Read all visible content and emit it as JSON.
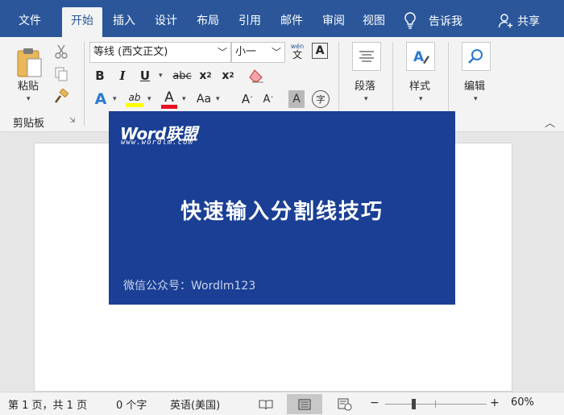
{
  "tabs": [
    {
      "label": "文件",
      "active": false
    },
    {
      "label": "开始",
      "active": true
    },
    {
      "label": "插入",
      "active": false
    },
    {
      "label": "设计",
      "active": false
    },
    {
      "label": "布局",
      "active": false
    },
    {
      "label": "引用",
      "active": false
    },
    {
      "label": "邮件",
      "active": false
    },
    {
      "label": "审阅",
      "active": false
    },
    {
      "label": "视图",
      "active": false
    }
  ],
  "tell_me": "告诉我",
  "share": "共享",
  "ribbon": {
    "clipboard": {
      "paste_label": "粘贴",
      "group_label": "剪贴板"
    },
    "font": {
      "font_name": "等线 (西文正文)",
      "font_size": "小一",
      "wen_top": "wén",
      "wen_char": "文",
      "bold": "B",
      "italic": "I",
      "underline": "U",
      "strike": "abc",
      "sub": "x",
      "sub_mark": "2",
      "sup": "x",
      "sup_mark": "2",
      "text_effect": "A",
      "highlight": "ab",
      "font_color": "A",
      "change_case": "Aa",
      "grow": "A",
      "shrink": "A",
      "char_shade": "A",
      "enclose": "字",
      "char_border": "A"
    },
    "paragraph_label": "段落",
    "styles_label": "样式",
    "editing_label": "编辑"
  },
  "banner": {
    "logo": "Word联盟",
    "logo_url": "www.wordlm.com",
    "headline": "快速输入分割线技巧",
    "wechat": "微信公众号：Wordlm123"
  },
  "status": {
    "page": "第 1 页，共 1 页",
    "words": "0 个字",
    "language": "英语(美国)",
    "zoom_minus": "−",
    "zoom_plus": "+",
    "zoom_percent": "60%",
    "zoom_level": 60
  },
  "colors": {
    "brand_blue": "#2b579a",
    "banner_blue": "#1a3f94",
    "highlight_yellow": "#ffff00",
    "font_red": "#e81123"
  }
}
